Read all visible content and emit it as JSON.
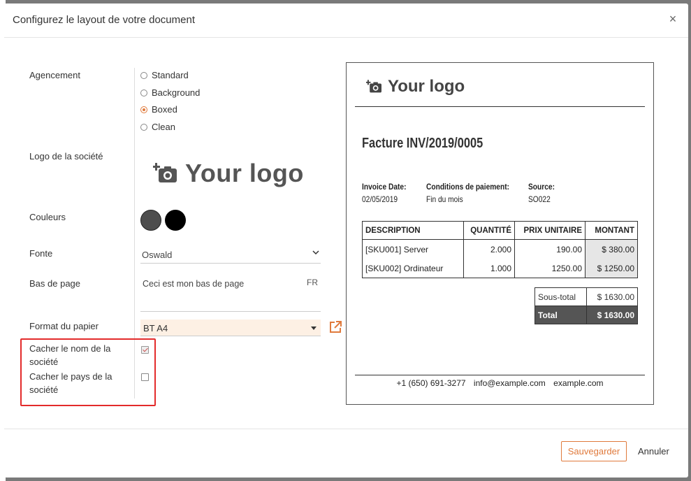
{
  "modal": {
    "title": "Configurez le layout de votre document",
    "close_glyph": "×"
  },
  "form": {
    "layout_label": "Agencement",
    "layout_options": [
      {
        "label": "Standard",
        "checked": false
      },
      {
        "label": "Background",
        "checked": false
      },
      {
        "label": "Boxed",
        "checked": true
      },
      {
        "label": "Clean",
        "checked": false
      }
    ],
    "logo_label": "Logo de la société",
    "logo_text": "Your logo",
    "colors_label": "Couleurs",
    "colors": [
      "#4d4d4d",
      "#000000"
    ],
    "font_label": "Fonte",
    "font_value": "Oswald",
    "footer_label": "Bas de page",
    "footer_value": "Ceci est mon bas de page",
    "footer_lang": "FR",
    "paper_label": "Format du papier",
    "paper_value": "BT A4",
    "hide_company_name_label": "Cacher le nom de la société",
    "hide_company_name_checked": true,
    "hide_company_country_label": "Cacher le pays de la société",
    "hide_company_country_checked": false
  },
  "preview": {
    "logo_text": "Your logo",
    "invoice_title": "Facture INV/2019/0005",
    "meta": [
      {
        "label": "Invoice Date:",
        "value": "02/05/2019"
      },
      {
        "label": "Conditions de paiement:",
        "value": "Fin du mois"
      },
      {
        "label": "Source:",
        "value": "SO022"
      }
    ],
    "table": {
      "headers": [
        "DESCRIPTION",
        "QUANTITÉ",
        "PRIX UNITAIRE",
        "MONTANT"
      ],
      "rows": [
        [
          "[SKU001] Server",
          "2.000",
          "190.00",
          "$ 380.00"
        ],
        [
          "[SKU002] Ordinateur",
          "1.000",
          "1250.00",
          "$ 1250.00"
        ]
      ]
    },
    "subtotal_label": "Sous-total",
    "subtotal_value": "$ 1630.00",
    "total_label": "Total",
    "total_value": "$ 1630.00",
    "footer": {
      "phone": "+1 (650) 691-3277",
      "email": "info@example.com",
      "website": "example.com"
    }
  },
  "buttons": {
    "save": "Sauvegarder",
    "cancel": "Annuler"
  }
}
